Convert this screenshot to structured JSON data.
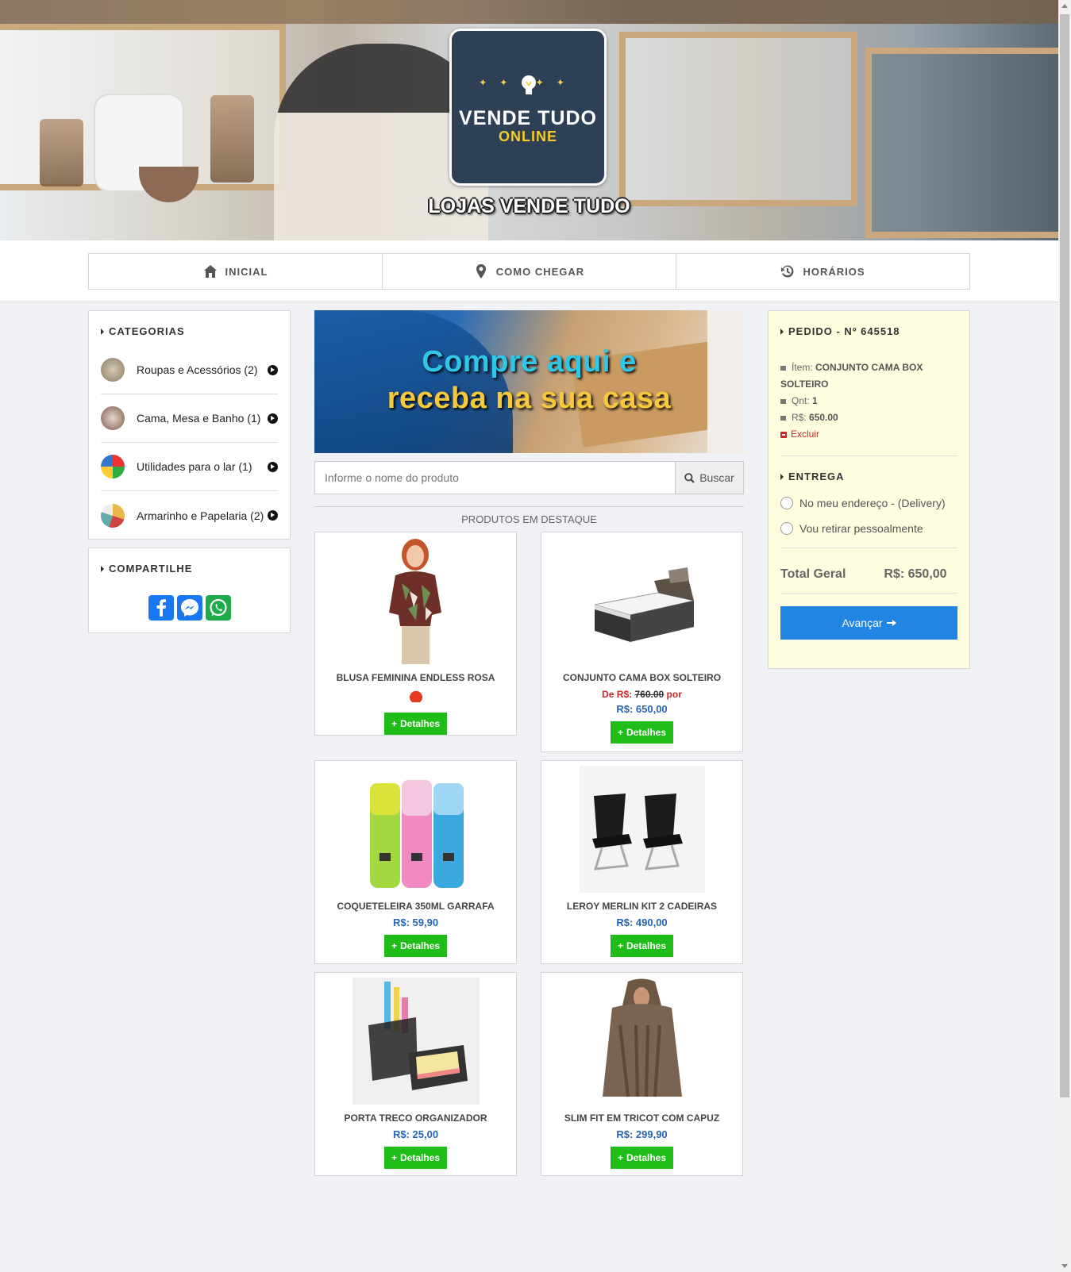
{
  "header": {
    "logo_line1": "VENDE TUDO",
    "logo_line2": "ONLINE",
    "store_name": "LOJAS VENDE TUDO"
  },
  "nav": {
    "tabs": [
      {
        "label": "INICIAL",
        "icon": "home-icon"
      },
      {
        "label": "COMO CHEGAR",
        "icon": "map-marker-icon"
      },
      {
        "label": "HORÁRIOS",
        "icon": "history-icon"
      }
    ]
  },
  "categories": {
    "title": "CATEGORIAS",
    "items": [
      {
        "label": "Roupas e Acessórios (2)",
        "color": "#a58b6e"
      },
      {
        "label": "Cama, Mesa e Banho (1)",
        "color": "#8a6d5f"
      },
      {
        "label": "Utilidades para o lar (1)",
        "color": "#3c9a46"
      },
      {
        "label": "Armarinho e Papelaria (2)",
        "color": "#d0b48c"
      }
    ]
  },
  "share": {
    "title": "COMPARTILHE",
    "icons": [
      "facebook-icon",
      "messenger-icon",
      "whatsapp-icon"
    ]
  },
  "banner": {
    "line1": "Compre aqui e",
    "line2": "receba na sua casa"
  },
  "search": {
    "placeholder": "Informe o nome do produto",
    "button": "Buscar"
  },
  "featured_title": "PRODUTOS EM DESTAQUE",
  "products": [
    {
      "name": "BLUSA FEMININA ENDLESS ROSA",
      "old_prefix": "",
      "old_price": "",
      "old_suffix": "",
      "price": "",
      "hot": true,
      "button": "Detalhes"
    },
    {
      "name": "CONJUNTO CAMA BOX SOLTEIRO",
      "old_prefix": "De R$:",
      "old_price": "760.00",
      "old_suffix": "por",
      "price": "R$: 650,00",
      "hot": false,
      "button": "Detalhes"
    },
    {
      "name": "COQUETELEIRA 350ML GARRAFA",
      "old_prefix": "",
      "old_price": "",
      "old_suffix": "",
      "price": "R$: 59,90",
      "hot": false,
      "button": "Detalhes"
    },
    {
      "name": "LEROY MERLIN KIT 2 CADEIRAS",
      "old_prefix": "",
      "old_price": "",
      "old_suffix": "",
      "price": "R$: 490,00",
      "hot": false,
      "button": "Detalhes"
    },
    {
      "name": "PORTA TRECO ORGANIZADOR",
      "old_prefix": "",
      "old_price": "",
      "old_suffix": "",
      "price": "R$: 25,00",
      "hot": false,
      "button": "Detalhes"
    },
    {
      "name": "SLIM FIT EM TRICOT COM CAPUZ",
      "old_prefix": "",
      "old_price": "",
      "old_suffix": "",
      "price": "R$: 299,90",
      "hot": false,
      "button": "Detalhes"
    }
  ],
  "order": {
    "title": "PEDIDO - Nº 645518",
    "item_label": "Ítem:",
    "item_value": "CONJUNTO CAMA BOX SOLTEIRO",
    "qty_label": "Qnt:",
    "qty_value": "1",
    "price_label": "R$:",
    "price_value": "650.00",
    "remove": "Excluir",
    "delivery_title": "ENTREGA",
    "delivery_options": [
      "No meu endereço - (Delivery)",
      "Vou retirar pessoalmente"
    ],
    "total_label": "Total Geral",
    "total_value": "R$: 650,00",
    "advance": "Avançar"
  }
}
